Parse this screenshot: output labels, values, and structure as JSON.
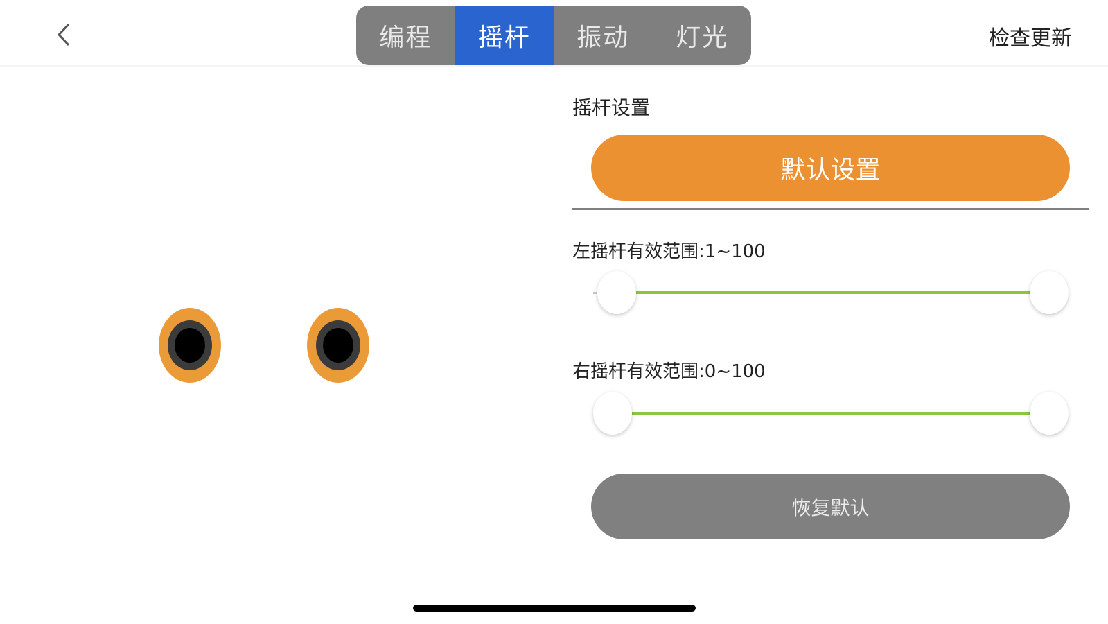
{
  "header": {
    "back_icon": "chevron-left-icon",
    "tabs": [
      {
        "label": "编程",
        "active": false
      },
      {
        "label": "摇杆",
        "active": true
      },
      {
        "label": "振动",
        "active": false
      },
      {
        "label": "灯光",
        "active": false
      }
    ],
    "check_update_label": "检查更新"
  },
  "robot_face": {
    "eye_color": "#eb9a38",
    "pupil_color": "#000000"
  },
  "settings": {
    "title": "摇杆设置",
    "default_button_label": "默认设置",
    "left_range": {
      "label": "左摇杆有效范围:1~100",
      "min": 1,
      "max": 100,
      "scale_min": 0,
      "scale_max": 100
    },
    "right_range": {
      "label": "右摇杆有效范围:0~100",
      "min": 0,
      "max": 100,
      "scale_min": 0,
      "scale_max": 100
    },
    "restore_button_label": "恢复默认"
  },
  "colors": {
    "active_tab": "#2a64cf",
    "tab_background": "#7f7f7f",
    "primary_button": "#eb9132",
    "secondary_button": "#808080",
    "slider_fill": "#8cc63f"
  }
}
